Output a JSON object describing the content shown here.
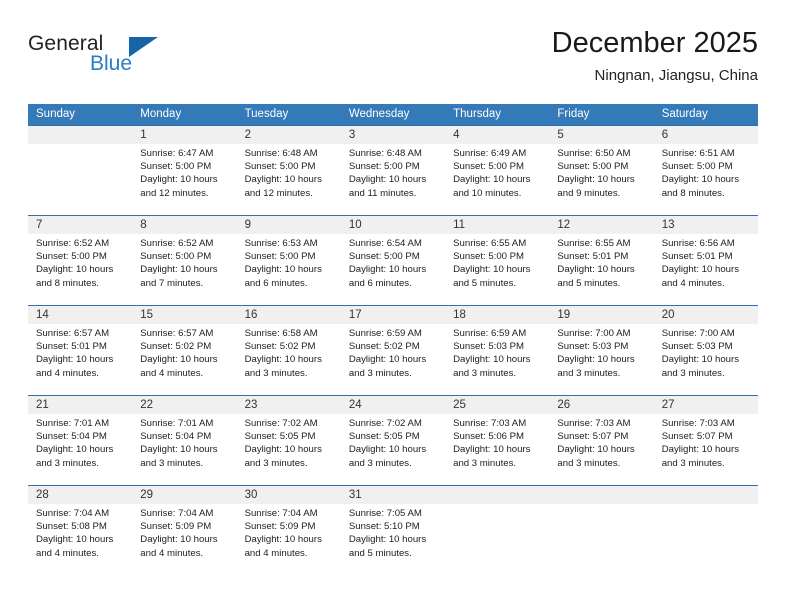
{
  "brand": {
    "name_part1": "General",
    "name_part2": "Blue"
  },
  "header": {
    "title": "December 2025",
    "subtitle": "Ningnan, Jiangsu, China"
  },
  "colors": {
    "header_blue": "#3479b8",
    "row_divider_blue": "#2e70b0",
    "day_band_gray": "#f0f0f0",
    "brand_blue": "#2b7cc4",
    "brand_triangle": "#1565a8"
  },
  "weekdays": [
    "Sunday",
    "Monday",
    "Tuesday",
    "Wednesday",
    "Thursday",
    "Friday",
    "Saturday"
  ],
  "weeks": [
    [
      {
        "day": "",
        "sunrise": "",
        "sunset": "",
        "daylight_line1": "",
        "daylight_line2": ""
      },
      {
        "day": "1",
        "sunrise": "Sunrise: 6:47 AM",
        "sunset": "Sunset: 5:00 PM",
        "daylight_line1": "Daylight: 10 hours",
        "daylight_line2": "and 12 minutes."
      },
      {
        "day": "2",
        "sunrise": "Sunrise: 6:48 AM",
        "sunset": "Sunset: 5:00 PM",
        "daylight_line1": "Daylight: 10 hours",
        "daylight_line2": "and 12 minutes."
      },
      {
        "day": "3",
        "sunrise": "Sunrise: 6:48 AM",
        "sunset": "Sunset: 5:00 PM",
        "daylight_line1": "Daylight: 10 hours",
        "daylight_line2": "and 11 minutes."
      },
      {
        "day": "4",
        "sunrise": "Sunrise: 6:49 AM",
        "sunset": "Sunset: 5:00 PM",
        "daylight_line1": "Daylight: 10 hours",
        "daylight_line2": "and 10 minutes."
      },
      {
        "day": "5",
        "sunrise": "Sunrise: 6:50 AM",
        "sunset": "Sunset: 5:00 PM",
        "daylight_line1": "Daylight: 10 hours",
        "daylight_line2": "and 9 minutes."
      },
      {
        "day": "6",
        "sunrise": "Sunrise: 6:51 AM",
        "sunset": "Sunset: 5:00 PM",
        "daylight_line1": "Daylight: 10 hours",
        "daylight_line2": "and 8 minutes."
      }
    ],
    [
      {
        "day": "7",
        "sunrise": "Sunrise: 6:52 AM",
        "sunset": "Sunset: 5:00 PM",
        "daylight_line1": "Daylight: 10 hours",
        "daylight_line2": "and 8 minutes."
      },
      {
        "day": "8",
        "sunrise": "Sunrise: 6:52 AM",
        "sunset": "Sunset: 5:00 PM",
        "daylight_line1": "Daylight: 10 hours",
        "daylight_line2": "and 7 minutes."
      },
      {
        "day": "9",
        "sunrise": "Sunrise: 6:53 AM",
        "sunset": "Sunset: 5:00 PM",
        "daylight_line1": "Daylight: 10 hours",
        "daylight_line2": "and 6 minutes."
      },
      {
        "day": "10",
        "sunrise": "Sunrise: 6:54 AM",
        "sunset": "Sunset: 5:00 PM",
        "daylight_line1": "Daylight: 10 hours",
        "daylight_line2": "and 6 minutes."
      },
      {
        "day": "11",
        "sunrise": "Sunrise: 6:55 AM",
        "sunset": "Sunset: 5:00 PM",
        "daylight_line1": "Daylight: 10 hours",
        "daylight_line2": "and 5 minutes."
      },
      {
        "day": "12",
        "sunrise": "Sunrise: 6:55 AM",
        "sunset": "Sunset: 5:01 PM",
        "daylight_line1": "Daylight: 10 hours",
        "daylight_line2": "and 5 minutes."
      },
      {
        "day": "13",
        "sunrise": "Sunrise: 6:56 AM",
        "sunset": "Sunset: 5:01 PM",
        "daylight_line1": "Daylight: 10 hours",
        "daylight_line2": "and 4 minutes."
      }
    ],
    [
      {
        "day": "14",
        "sunrise": "Sunrise: 6:57 AM",
        "sunset": "Sunset: 5:01 PM",
        "daylight_line1": "Daylight: 10 hours",
        "daylight_line2": "and 4 minutes."
      },
      {
        "day": "15",
        "sunrise": "Sunrise: 6:57 AM",
        "sunset": "Sunset: 5:02 PM",
        "daylight_line1": "Daylight: 10 hours",
        "daylight_line2": "and 4 minutes."
      },
      {
        "day": "16",
        "sunrise": "Sunrise: 6:58 AM",
        "sunset": "Sunset: 5:02 PM",
        "daylight_line1": "Daylight: 10 hours",
        "daylight_line2": "and 3 minutes."
      },
      {
        "day": "17",
        "sunrise": "Sunrise: 6:59 AM",
        "sunset": "Sunset: 5:02 PM",
        "daylight_line1": "Daylight: 10 hours",
        "daylight_line2": "and 3 minutes."
      },
      {
        "day": "18",
        "sunrise": "Sunrise: 6:59 AM",
        "sunset": "Sunset: 5:03 PM",
        "daylight_line1": "Daylight: 10 hours",
        "daylight_line2": "and 3 minutes."
      },
      {
        "day": "19",
        "sunrise": "Sunrise: 7:00 AM",
        "sunset": "Sunset: 5:03 PM",
        "daylight_line1": "Daylight: 10 hours",
        "daylight_line2": "and 3 minutes."
      },
      {
        "day": "20",
        "sunrise": "Sunrise: 7:00 AM",
        "sunset": "Sunset: 5:03 PM",
        "daylight_line1": "Daylight: 10 hours",
        "daylight_line2": "and 3 minutes."
      }
    ],
    [
      {
        "day": "21",
        "sunrise": "Sunrise: 7:01 AM",
        "sunset": "Sunset: 5:04 PM",
        "daylight_line1": "Daylight: 10 hours",
        "daylight_line2": "and 3 minutes."
      },
      {
        "day": "22",
        "sunrise": "Sunrise: 7:01 AM",
        "sunset": "Sunset: 5:04 PM",
        "daylight_line1": "Daylight: 10 hours",
        "daylight_line2": "and 3 minutes."
      },
      {
        "day": "23",
        "sunrise": "Sunrise: 7:02 AM",
        "sunset": "Sunset: 5:05 PM",
        "daylight_line1": "Daylight: 10 hours",
        "daylight_line2": "and 3 minutes."
      },
      {
        "day": "24",
        "sunrise": "Sunrise: 7:02 AM",
        "sunset": "Sunset: 5:05 PM",
        "daylight_line1": "Daylight: 10 hours",
        "daylight_line2": "and 3 minutes."
      },
      {
        "day": "25",
        "sunrise": "Sunrise: 7:03 AM",
        "sunset": "Sunset: 5:06 PM",
        "daylight_line1": "Daylight: 10 hours",
        "daylight_line2": "and 3 minutes."
      },
      {
        "day": "26",
        "sunrise": "Sunrise: 7:03 AM",
        "sunset": "Sunset: 5:07 PM",
        "daylight_line1": "Daylight: 10 hours",
        "daylight_line2": "and 3 minutes."
      },
      {
        "day": "27",
        "sunrise": "Sunrise: 7:03 AM",
        "sunset": "Sunset: 5:07 PM",
        "daylight_line1": "Daylight: 10 hours",
        "daylight_line2": "and 3 minutes."
      }
    ],
    [
      {
        "day": "28",
        "sunrise": "Sunrise: 7:04 AM",
        "sunset": "Sunset: 5:08 PM",
        "daylight_line1": "Daylight: 10 hours",
        "daylight_line2": "and 4 minutes."
      },
      {
        "day": "29",
        "sunrise": "Sunrise: 7:04 AM",
        "sunset": "Sunset: 5:09 PM",
        "daylight_line1": "Daylight: 10 hours",
        "daylight_line2": "and 4 minutes."
      },
      {
        "day": "30",
        "sunrise": "Sunrise: 7:04 AM",
        "sunset": "Sunset: 5:09 PM",
        "daylight_line1": "Daylight: 10 hours",
        "daylight_line2": "and 4 minutes."
      },
      {
        "day": "31",
        "sunrise": "Sunrise: 7:05 AM",
        "sunset": "Sunset: 5:10 PM",
        "daylight_line1": "Daylight: 10 hours",
        "daylight_line2": "and 5 minutes."
      },
      {
        "day": "",
        "sunrise": "",
        "sunset": "",
        "daylight_line1": "",
        "daylight_line2": ""
      },
      {
        "day": "",
        "sunrise": "",
        "sunset": "",
        "daylight_line1": "",
        "daylight_line2": ""
      },
      {
        "day": "",
        "sunrise": "",
        "sunset": "",
        "daylight_line1": "",
        "daylight_line2": ""
      }
    ]
  ]
}
